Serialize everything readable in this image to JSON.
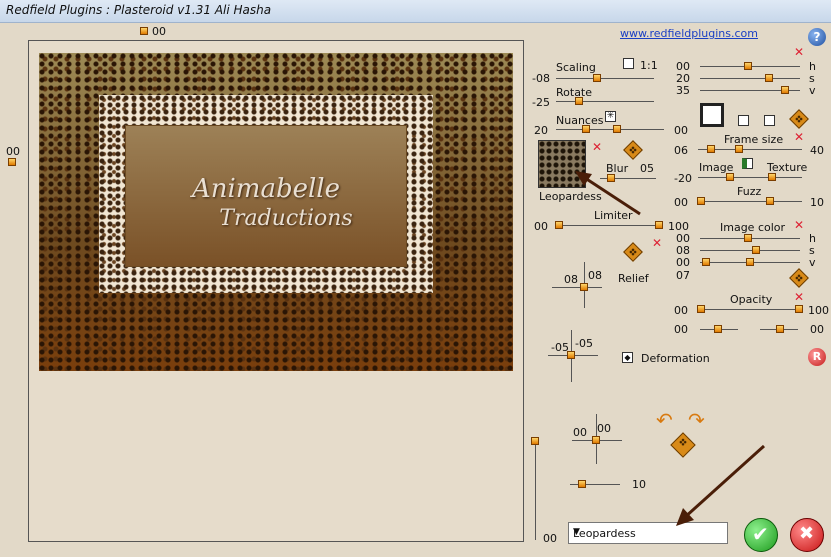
{
  "window": {
    "title": "Redfield Plugins : Plasteroid v1.31   Ali Hasha",
    "link": "www.redfieldplugins.com"
  },
  "preview": {
    "top_value": "00",
    "left_value": "00",
    "bottom_value": "00",
    "watermark_line1": "Animabelle",
    "watermark_line2": "Traductions"
  },
  "scaling": {
    "label": "Scaling",
    "ratio": "1:1",
    "value": "-08"
  },
  "rotate": {
    "label": "Rotate",
    "value": "-25"
  },
  "nuances": {
    "label": "Nuances",
    "value_left": "20",
    "value_right": "00"
  },
  "texture": {
    "name": "Leopardess",
    "blur_label": "Blur",
    "blur_value": "05"
  },
  "limiter": {
    "label": "Limiter",
    "value_left": "00",
    "value_right": "100"
  },
  "relief": {
    "label": "Relief",
    "value_h": "08",
    "value_v": "08"
  },
  "deformation": {
    "label": "Deformation",
    "value_h": "-05",
    "value_v": "-05"
  },
  "lower_xy": {
    "value_h": "00",
    "value_v": "00"
  },
  "lower_slider": {
    "value": "10"
  },
  "hsv_top": {
    "h_label": "h",
    "s_label": "s",
    "v_label": "v",
    "h": "00",
    "s": "20",
    "v": "35"
  },
  "frame_size": {
    "label": "Frame size",
    "value_left": "06",
    "value_right": "40"
  },
  "image_texture": {
    "image_label": "Image",
    "texture_label": "Texture",
    "value": "-20"
  },
  "fuzz": {
    "label": "Fuzz",
    "value_left": "00",
    "value_right": "10"
  },
  "image_color": {
    "label": "Image color",
    "h": "00",
    "s": "08",
    "v": "00",
    "h_label": "h",
    "s_label": "s",
    "v_label": "v",
    "extra": "07"
  },
  "opacity": {
    "label": "Opacity",
    "value_left": "00",
    "value_right": "100",
    "row2_left": "00",
    "row2_right": "00"
  },
  "preset_select": {
    "selected": "Leopardess"
  },
  "icons": {
    "help": "?",
    "reset": "R"
  }
}
